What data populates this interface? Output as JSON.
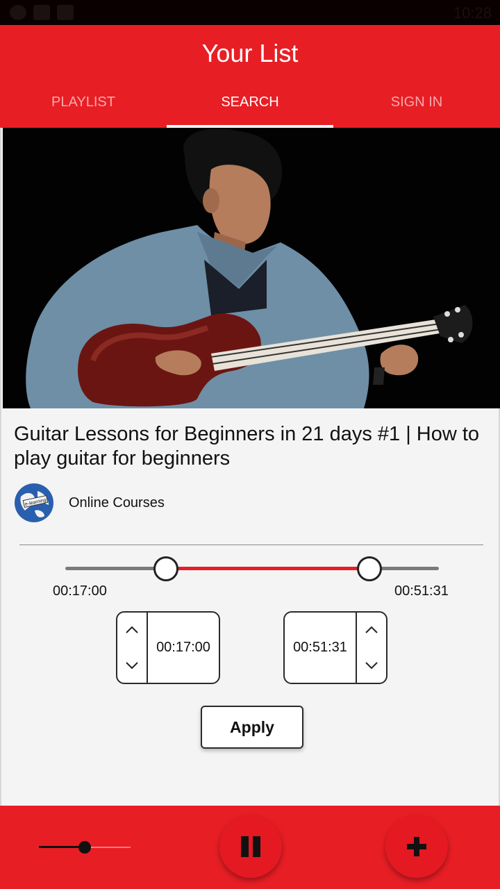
{
  "status_bar": {
    "time": "10:28",
    "icons": [
      "notification-icon",
      "image-icon",
      "video-icon"
    ]
  },
  "app_title": "Your List",
  "tabs": [
    {
      "label": "PLAYLIST",
      "active": false
    },
    {
      "label": "SEARCH",
      "active": true
    },
    {
      "label": "SIGN IN",
      "active": false
    }
  ],
  "video": {
    "title": "Guitar Lessons for Beginners in 21 days #1 | How to play guitar for beginners",
    "channel": {
      "name": "Online Courses",
      "logo_text": "e-learning"
    }
  },
  "range": {
    "start_label": "00:17:00",
    "end_label": "00:51:31",
    "start_fraction": 0.269,
    "end_fraction": 0.815
  },
  "start_stepper": {
    "value": "00:17:00"
  },
  "end_stepper": {
    "value": "00:51:31"
  },
  "apply_label": "Apply",
  "player": {
    "volume_fraction": 0.5,
    "state": "playing"
  },
  "colors": {
    "accent": "#e81e25",
    "background": "#f4f4f4"
  }
}
